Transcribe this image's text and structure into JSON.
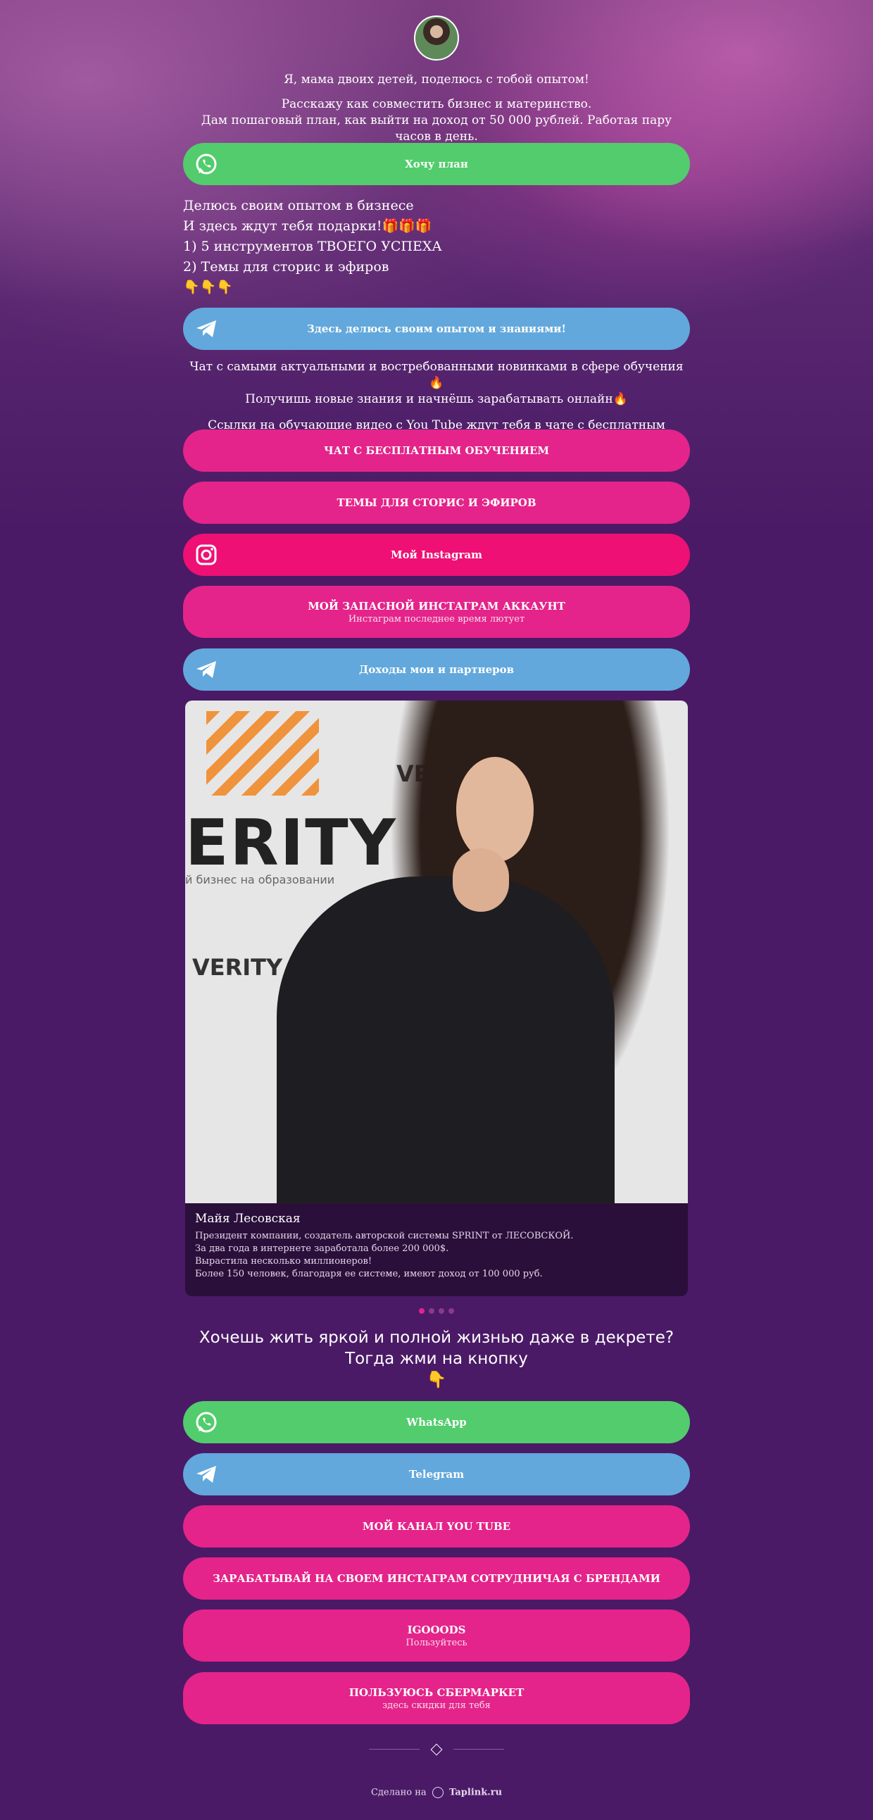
{
  "intro": {
    "line1": "Я, мама двоих детей, поделюсь с тобой опытом!",
    "line2": "Расскажу как совместить бизнес и материнство.",
    "line3": "Дам пошаговый план, как выйти на доход от 50 000 рублей. Работая пару часов в день."
  },
  "btn_plan": "Хочу план",
  "share": {
    "l1": "Делюсь своим опытом в бизнесе",
    "l2": "И здесь ждут тебя подарки!🎁🎁🎁",
    "l3": "1) 5 инструментов ТВОЕГО УСПЕХА",
    "l4": "2) Темы для сторис и эфиров",
    "l5": "👇👇👇"
  },
  "btn_share": "Здесь делюсь своим опытом и знаниями!",
  "chat": {
    "l1": "Чат с самыми актуальными и востребованными новинками в сфере обучения🔥",
    "l2": "Получишь новые знания и начнёшь зарабатывать онлайн🔥",
    "l3": "Ссылки на обучающие видео с You Tube ждут тебя в чате с бесплатным обучением!"
  },
  "btn_free_chat": "ЧАТ С БЕСПЛАТНЫМ ОБУЧЕНИЕМ",
  "btn_topics": "ТЕМЫ ДЛЯ СТОРИС И ЭФИРОВ",
  "btn_instagram": "Мой Instagram",
  "btn_backup": {
    "title": "МОЙ ЗАПАСНОЙ ИНСТАГРАМ АККАУНТ",
    "sub": "Инстаграм последнее время лютует"
  },
  "btn_income": "Доходы мои и партнеров",
  "card": {
    "brand": "ERITY",
    "brand_left": "VERITY",
    "brand_sub": "й бизнес на образовании",
    "name": "Майя Лесовская",
    "l1": "Президент компании, создатель авторской системы SPRINT от ЛЕСОВСКОЙ.",
    "l2": "За два года в интернете заработала более 200 000$.",
    "l3": "Вырастила несколько миллионеров!",
    "l4": "Более 150 человек, благодаря ее системе, имеют доход от 100 000 руб."
  },
  "call": {
    "l1": "Хочешь жить яркой и полной жизнью даже в декрете?",
    "l2": "Тогда жми на кнопку",
    "l3": "👇"
  },
  "btn_whatsapp": "WhatsApp",
  "btn_telegram": "Telegram",
  "btn_youtube": "МОЙ КАНАЛ YOU TUBE",
  "btn_brands": "ЗАРАБАТЫВАЙ НА СВОЕМ ИНСТАГРАМ СОТРУДНИЧАЯ С БРЕНДАМИ",
  "btn_igooods": {
    "title": "IGOOODS",
    "sub": "Пользуйтесь"
  },
  "btn_sber": {
    "title": "ПОЛЬЗУЮСЬ СБЕРМАРКЕТ",
    "sub": "здесь скидки для тебя"
  },
  "footer": {
    "made": "Сделано на",
    "brand": "Taplink.ru"
  },
  "colors": {
    "green": "#52cc6c",
    "blue": "#62a8dc",
    "pink": "#e4248a",
    "bg": "#4a1a66"
  }
}
